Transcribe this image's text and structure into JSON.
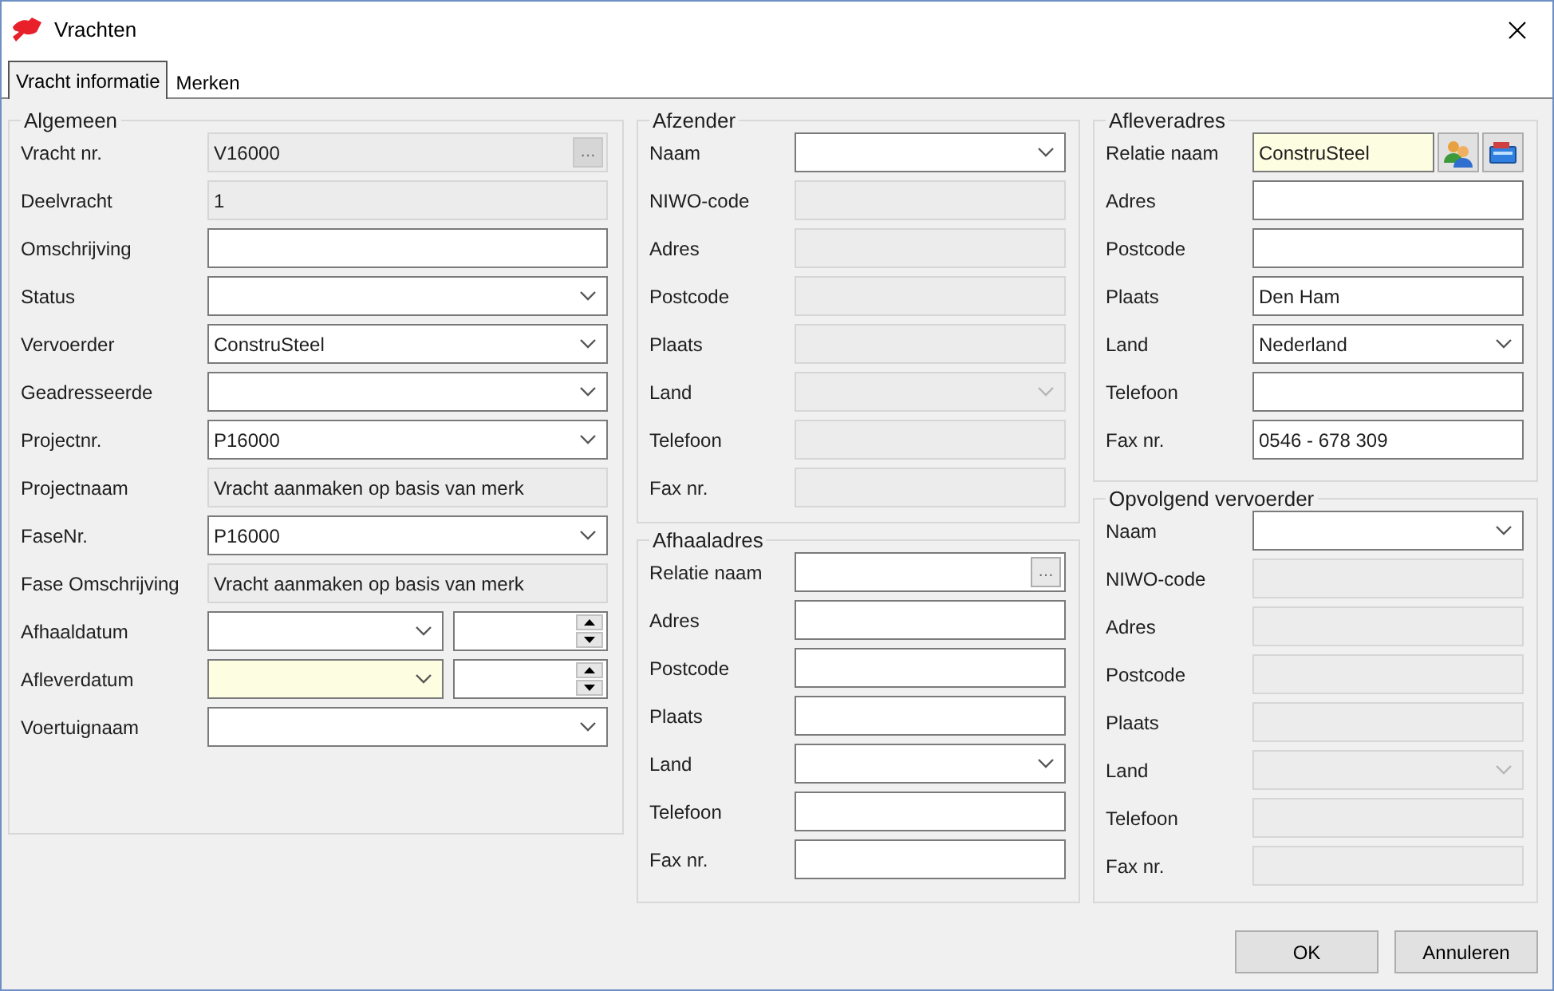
{
  "window": {
    "title": "Vrachten"
  },
  "tabs": [
    {
      "label": "Vracht informatie",
      "selected": true
    },
    {
      "label": "Merken",
      "selected": false
    }
  ],
  "columns": [
    {
      "groups": [
        {
          "title": "Algemeen",
          "fields": [
            {
              "label": "Vracht nr.",
              "kind": "lookup",
              "value": "V16000",
              "disabled": true,
              "highlighted": false,
              "button_label": "…"
            },
            {
              "label": "Deelvracht",
              "kind": "text",
              "value": "1",
              "disabled": true,
              "highlighted": false
            },
            {
              "label": "Omschrijving",
              "kind": "text",
              "disabled": false,
              "highlighted": false
            },
            {
              "label": "Status",
              "kind": "combo",
              "disabled": false,
              "highlighted": false
            },
            {
              "label": "Vervoerder",
              "kind": "combo",
              "value": "ConstruSteel",
              "disabled": false,
              "highlighted": false
            },
            {
              "label": "Geadresseerde",
              "kind": "combo",
              "disabled": false,
              "highlighted": false
            },
            {
              "label": "Projectnr.",
              "kind": "combo",
              "value": "P16000",
              "disabled": false,
              "highlighted": false
            },
            {
              "label": "Projectnaam",
              "kind": "text",
              "value": "Vracht aanmaken op basis van merk",
              "disabled": true,
              "highlighted": false
            },
            {
              "label": "FaseNr.",
              "kind": "combo",
              "value": "P16000",
              "disabled": false,
              "highlighted": false
            },
            {
              "label": "Fase Omschrijving",
              "kind": "text",
              "value": "Vracht aanmaken op basis van merk",
              "disabled": true,
              "highlighted": false
            },
            {
              "label": "Afhaaldatum",
              "kind": "datetime",
              "disabled": false,
              "highlighted": false
            },
            {
              "label": "Afleverdatum",
              "kind": "datetime",
              "disabled": false,
              "highlighted": true
            },
            {
              "label": "Voertuignaam",
              "kind": "combo",
              "disabled": false,
              "highlighted": false
            }
          ]
        }
      ]
    },
    {
      "groups": [
        {
          "title": "Afzender",
          "fields": [
            {
              "label": "Naam",
              "kind": "combo",
              "disabled": false,
              "highlighted": false
            },
            {
              "label": "NIWO-code",
              "kind": "text",
              "disabled": true,
              "highlighted": false
            },
            {
              "label": "Adres",
              "kind": "text",
              "disabled": true,
              "highlighted": false
            },
            {
              "label": "Postcode",
              "kind": "text",
              "disabled": true,
              "highlighted": false
            },
            {
              "label": "Plaats",
              "kind": "text",
              "disabled": true,
              "highlighted": false
            },
            {
              "label": "Land",
              "kind": "combo",
              "disabled": true,
              "highlighted": false
            },
            {
              "label": "Telefoon",
              "kind": "text",
              "disabled": true,
              "highlighted": false
            },
            {
              "label": "Fax nr.",
              "kind": "text",
              "disabled": true,
              "highlighted": false
            }
          ]
        },
        {
          "title": "Afhaaladres",
          "fields": [
            {
              "label": "Relatie naam",
              "kind": "lookup",
              "disabled": false,
              "highlighted": false,
              "button_label": "…"
            },
            {
              "label": "Adres",
              "kind": "text",
              "disabled": false,
              "highlighted": false
            },
            {
              "label": "Postcode",
              "kind": "text",
              "disabled": false,
              "highlighted": false
            },
            {
              "label": "Plaats",
              "kind": "text",
              "disabled": false,
              "highlighted": false
            },
            {
              "label": "Land",
              "kind": "combo",
              "disabled": false,
              "highlighted": false
            },
            {
              "label": "Telefoon",
              "kind": "text",
              "disabled": false,
              "highlighted": false
            },
            {
              "label": "Fax nr.",
              "kind": "text",
              "disabled": false,
              "highlighted": false
            }
          ]
        }
      ]
    },
    {
      "groups": [
        {
          "title": "Afleveradres",
          "fields": [
            {
              "label": "Relatie naam",
              "kind": "relation",
              "value": "ConstruSteel",
              "disabled": false,
              "highlighted": true
            },
            {
              "label": "Adres",
              "kind": "text",
              "disabled": false,
              "highlighted": false
            },
            {
              "label": "Postcode",
              "kind": "text",
              "disabled": false,
              "highlighted": false
            },
            {
              "label": "Plaats",
              "kind": "text",
              "value": "Den Ham",
              "disabled": false,
              "highlighted": false
            },
            {
              "label": "Land",
              "kind": "combo",
              "value": "Nederland",
              "disabled": false,
              "highlighted": false
            },
            {
              "label": "Telefoon",
              "kind": "text",
              "disabled": false,
              "highlighted": false
            },
            {
              "label": "Fax nr.",
              "kind": "text",
              "value": "0546 - 678 309",
              "disabled": false,
              "highlighted": false
            }
          ]
        },
        {
          "title": "Opvolgend vervoerder",
          "fields": [
            {
              "label": "Naam",
              "kind": "combo",
              "disabled": false,
              "highlighted": false
            },
            {
              "label": "NIWO-code",
              "kind": "text",
              "disabled": true,
              "highlighted": false
            },
            {
              "label": "Adres",
              "kind": "text",
              "disabled": true,
              "highlighted": false
            },
            {
              "label": "Postcode",
              "kind": "text",
              "disabled": true,
              "highlighted": false
            },
            {
              "label": "Plaats",
              "kind": "text",
              "disabled": true,
              "highlighted": false
            },
            {
              "label": "Land",
              "kind": "combo",
              "disabled": true,
              "highlighted": false
            },
            {
              "label": "Telefoon",
              "kind": "text",
              "disabled": true,
              "highlighted": false
            },
            {
              "label": "Fax nr.",
              "kind": "text",
              "disabled": true,
              "highlighted": false
            }
          ]
        }
      ]
    }
  ],
  "buttons": [
    "OK",
    "Annuleren"
  ]
}
